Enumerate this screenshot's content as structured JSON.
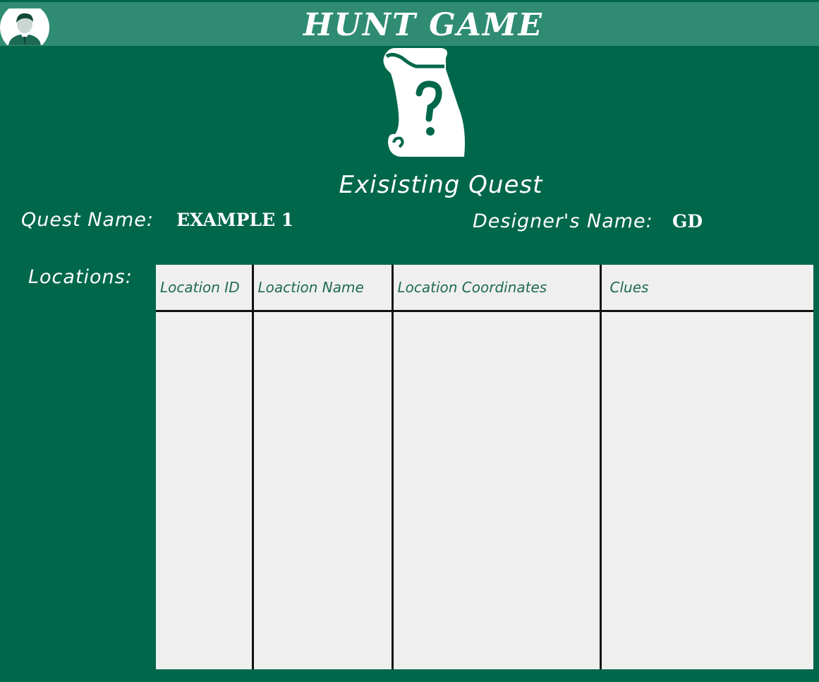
{
  "app": {
    "title": "HUNT GAME",
    "accent_color": "#00674b",
    "header_color": "#2f8c73"
  },
  "header": {
    "avatar_icon": "user-avatar-icon"
  },
  "hero": {
    "icon": "scroll-question-icon",
    "title": "Exisisting Quest"
  },
  "quest": {
    "name_label": "Quest Name:",
    "name_value": "EXAMPLE 1",
    "designer_label": "Designer's Name:",
    "designer_value": "GD"
  },
  "locations": {
    "label": "Locations:",
    "columns": [
      "Location ID",
      "Loaction Name",
      "Location Coordinates",
      "Clues"
    ],
    "rows": []
  }
}
